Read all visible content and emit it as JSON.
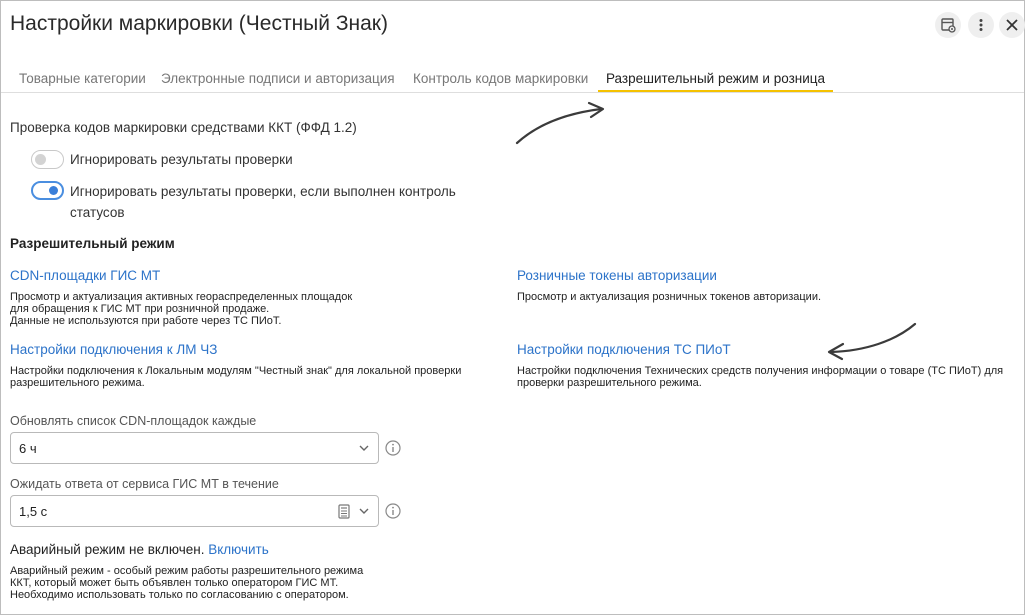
{
  "window": {
    "title": "Настройки маркировки (Честный Знак)"
  },
  "header_icons": [
    "settings-table-icon",
    "more-vert-icon",
    "close-icon"
  ],
  "tabs": [
    {
      "label": "Товарные категории",
      "active": false
    },
    {
      "label": "Электронные подписи и авторизация",
      "active": false
    },
    {
      "label": "Контроль кодов маркировки",
      "active": false
    },
    {
      "label": "Разрешительный режим и розница",
      "active": true
    }
  ],
  "colors": {
    "accent": "#f5c200",
    "link": "#2c73c9",
    "toggle_on": "#3a7fd9"
  },
  "kkt_check": {
    "heading": "Проверка кодов маркировки средствами ККТ (ФФД 1.2)",
    "option1": {
      "label": "Игнорировать результаты проверки",
      "checked": false
    },
    "option2": {
      "label_line1": "Игнорировать результаты проверки, если выполнен контроль",
      "label_line2": "статусов",
      "checked": true
    }
  },
  "permit": {
    "heading": "Разрешительный режим",
    "cdn": {
      "link": "CDN-площадки ГИС МТ",
      "desc": [
        "Просмотр и актуализация активных геораспределенных площадок",
        "для обращения к ГИС МТ при розничной продаже.",
        "Данные не используются при работе через ТС ПИоТ."
      ]
    },
    "tokens": {
      "link": "Розничные токены авторизации",
      "desc": [
        "Просмотр и актуализация розничных токенов авторизации."
      ]
    },
    "lm": {
      "link": "Настройки подключения к ЛМ ЧЗ",
      "desc": [
        "Настройки подключения к Локальным модулям \"Честный знак\" для локальной проверки",
        "разрешительного режима."
      ]
    },
    "piot": {
      "link": "Настройки подключения ТС ПИоТ",
      "desc": [
        "Настройки подключения Технических средств получения информации о товаре (ТС ПИоТ) для",
        "проверки разрешительного режима."
      ]
    }
  },
  "cdn_refresh": {
    "label": "Обновлять список CDN-площадок каждые",
    "value": "6 ч"
  },
  "gis_timeout": {
    "label": "Ожидать ответа от сервиса ГИС МТ в течение",
    "value": "1,5 с"
  },
  "emergency": {
    "status": "Аварийный режим не включен.",
    "action": "Включить",
    "desc": [
      "Аварийный режим - особый режим работы разрешительного режима",
      "ККТ, который может быть объявлен только оператором ГИС МТ.",
      "Необходимо использовать только по согласованию с оператором."
    ]
  }
}
